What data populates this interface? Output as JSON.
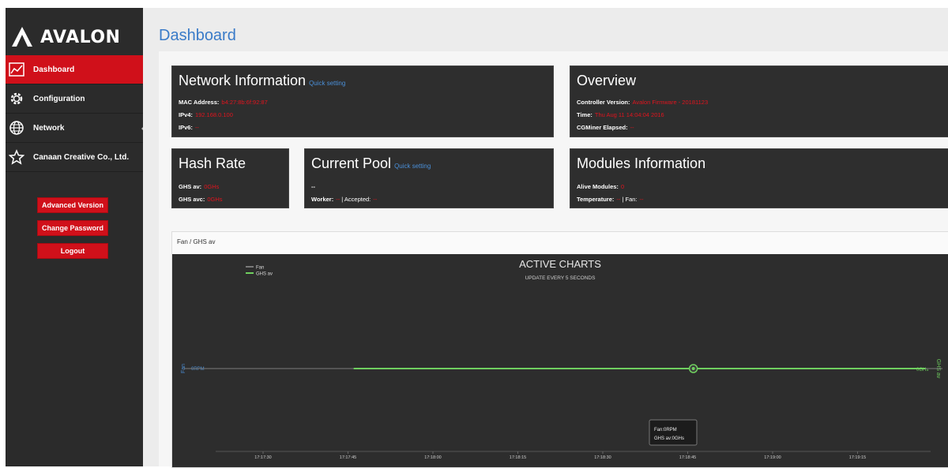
{
  "app": {
    "logo_text": "AVALON"
  },
  "sidebar": {
    "items": [
      {
        "label": "Dashboard",
        "icon": "line-chart-icon",
        "active": true
      },
      {
        "label": "Configuration",
        "icon": "gear-icon",
        "active": false
      },
      {
        "label": "Network",
        "icon": "globe-icon",
        "active": false
      },
      {
        "label": "Canaan Creative Co., Ltd.",
        "icon": "star-icon",
        "active": false
      }
    ],
    "buttons": {
      "advanced": "Advanced Version",
      "password": "Change Password",
      "logout": "Logout"
    }
  },
  "page": {
    "title": "Dashboard"
  },
  "network": {
    "title": "Network Information",
    "quick": "Quick setting",
    "mac_label": "MAC Address:",
    "mac_value": "b4:27:8b:6f:92:87",
    "ipv4_label": "IPv4:",
    "ipv4_value": "192.168.0.100",
    "ipv6_label": "IPv6:",
    "ipv6_value": "--"
  },
  "overview": {
    "title": "Overview",
    "controller_label": "Controller Version:",
    "controller_value": "Avalon Firmware - 20181123",
    "time_label": "Time:",
    "time_value": "Thu Aug 11 14:04:04 2016",
    "elapsed_label": "CGMiner Elapsed:",
    "elapsed_value": "--"
  },
  "hashrate": {
    "title": "Hash Rate",
    "av_label": "GHS av:",
    "av_value": "0GHs",
    "avc_label": "GHS avc:",
    "avc_value": "0GHs"
  },
  "pool": {
    "title": "Current Pool",
    "quick": "Quick setting",
    "url": "--",
    "worker_label": "Worker:",
    "worker_value": "--",
    "accepted_label": "| Accepted:",
    "accepted_value": "--"
  },
  "modules": {
    "title": "Modules Information",
    "alive_label": "Alive Modules:",
    "alive_value": "0",
    "temp_label": "Temperature:",
    "temp_value": "--",
    "fan_label": "| Fan:",
    "fan_value": "--"
  },
  "chart_panel": {
    "heading": "Fan / GHS av"
  },
  "colors": {
    "accent_red": "#d0101a",
    "link_blue": "#3a7bc8",
    "fan_line": "#7a7a7a",
    "ghs_line": "#6fcf5f"
  },
  "chart_data": {
    "type": "line",
    "title": "ACTIVE CHARTS",
    "subtitle": "UPDATE EVERY 5 SECONDS",
    "left_axis_label": "Fan",
    "left_tick": "0RPM",
    "right_axis_label": "GHS av",
    "right_tick": "0GHs",
    "legend_position": "top-left",
    "categories": [
      "17:17:30",
      "17:17:45",
      "17:18:00",
      "17:18:15",
      "17:18:30",
      "17:18:45",
      "17:19:00",
      "17:19:15"
    ],
    "series": [
      {
        "name": "Fan",
        "color": "#7a7a7a",
        "x_start": "17:17:16",
        "x_end": "17:19:30",
        "value": 0
      },
      {
        "name": "GHS av",
        "color": "#6fcf5f",
        "x_start": "17:17:46",
        "x_end": "17:19:27",
        "value": 0
      }
    ],
    "highlight_x": "17:18:46",
    "tooltip": {
      "line1": "Fan:0RPM",
      "line2": "GHS av:0GHs"
    }
  }
}
